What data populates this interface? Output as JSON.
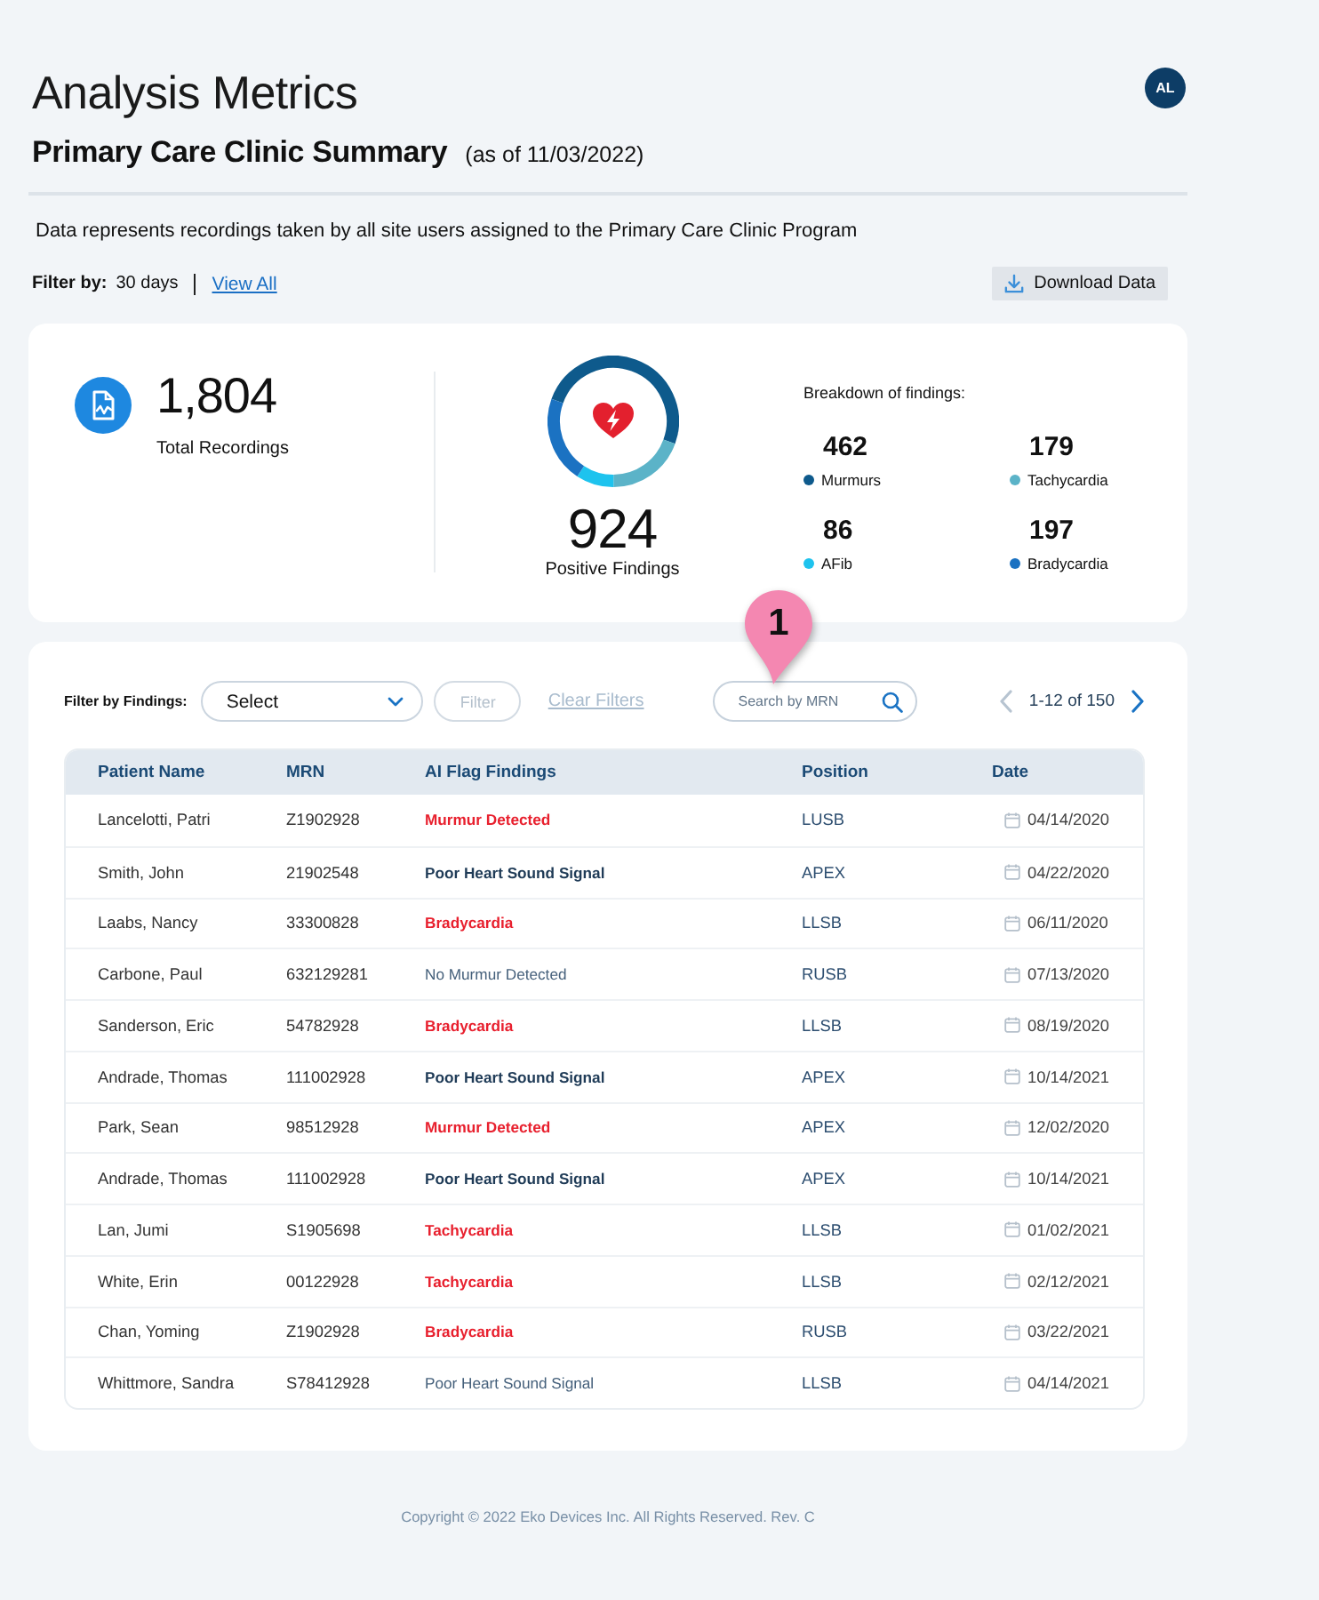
{
  "header": {
    "title": "Analysis Metrics",
    "avatar": {
      "initials": "AL"
    },
    "subtitle": "Primary Care Clinic Summary",
    "as_of": "(as of 11/03/2022)"
  },
  "description": "Data represents recordings taken by all site users assigned to the Primary Care Clinic Program",
  "filter_bar": {
    "label": "Filter by:",
    "value": "30 days",
    "link": "View All",
    "download_button": "Download Data"
  },
  "summary": {
    "total": {
      "value": "1,804",
      "label": "Total Recordings"
    },
    "positive": {
      "value": "924",
      "label": "Positive Findings"
    },
    "breakdown": {
      "title": "Breakdown of findings:",
      "items": [
        {
          "value": "462",
          "label": "Murmurs",
          "color": "#0e5a8c"
        },
        {
          "value": "179",
          "label": "Tachycardia",
          "color": "#5bb3c8"
        },
        {
          "value": "86",
          "label": "AFib",
          "color": "#1ec3ee"
        },
        {
          "value": "197",
          "label": "Bradycardia",
          "color": "#1b72c2"
        }
      ]
    }
  },
  "table_toolbar": {
    "label": "Filter by Findings:",
    "select": {
      "value": "Select"
    },
    "filter_button": {
      "label": "Filter",
      "disabled": true
    },
    "clear_filters": {
      "label": "Clear Filters",
      "disabled": true
    },
    "search": {
      "placeholder": "Search by MRN"
    },
    "pagination": {
      "range": "1-12 of 150",
      "previous_disabled": true,
      "next_disabled": false
    }
  },
  "table": {
    "columns": [
      "Patient Name",
      "MRN",
      "AI Flag Findings",
      "Position",
      "Date"
    ],
    "rows": [
      {
        "patient_name": "Lancelotti, Patri",
        "mrn": "Z1902928",
        "finding": {
          "text": "Murmur Detected",
          "kind": "alert"
        },
        "position": "LUSB",
        "date": "04/14/2020"
      },
      {
        "patient_name": "Smith, John",
        "mrn": "21902548",
        "finding": {
          "text": "Poor Heart Sound Signal",
          "kind": "emphasis"
        },
        "position": "APEX",
        "date": "04/22/2020"
      },
      {
        "patient_name": "Laabs, Nancy",
        "mrn": "33300828",
        "finding": {
          "text": "Bradycardia",
          "kind": "alert"
        },
        "position": "LLSB",
        "date": "06/11/2020"
      },
      {
        "patient_name": "Carbone, Paul",
        "mrn": "632129281",
        "finding": {
          "text": "No Murmur Detected",
          "kind": "plain"
        },
        "position": "RUSB",
        "date": "07/13/2020"
      },
      {
        "patient_name": "Sanderson, Eric",
        "mrn": "54782928",
        "finding": {
          "text": "Bradycardia",
          "kind": "alert"
        },
        "position": "LLSB",
        "date": "08/19/2020"
      },
      {
        "patient_name": "Andrade, Thomas",
        "mrn": "111002928",
        "finding": {
          "text": "Poor Heart Sound Signal",
          "kind": "emphasis"
        },
        "position": "APEX",
        "date": "10/14/2021"
      },
      {
        "patient_name": "Park, Sean",
        "mrn": "98512928",
        "finding": {
          "text": "Murmur Detected",
          "kind": "alert"
        },
        "position": "APEX",
        "date": "12/02/2020"
      },
      {
        "patient_name": "Andrade, Thomas",
        "mrn": "111002928",
        "finding": {
          "text": "Poor Heart Sound Signal",
          "kind": "emphasis"
        },
        "position": "APEX",
        "date": "10/14/2021"
      },
      {
        "patient_name": "Lan, Jumi",
        "mrn": "S1905698",
        "finding": {
          "text": "Tachycardia",
          "kind": "alert"
        },
        "position": "LLSB",
        "date": "01/02/2021"
      },
      {
        "patient_name": "White, Erin",
        "mrn": "00122928",
        "finding": {
          "text": "Tachycardia",
          "kind": "alert"
        },
        "position": "LLSB",
        "date": "02/12/2021"
      },
      {
        "patient_name": "Chan, Yoming",
        "mrn": "Z1902928",
        "finding": {
          "text": "Bradycardia",
          "kind": "alert"
        },
        "position": "RUSB",
        "date": "03/22/2021"
      },
      {
        "patient_name": "Whittmore, Sandra",
        "mrn": "S78412928",
        "finding": {
          "text": "Poor Heart Sound Signal",
          "kind": "plain"
        },
        "position": "LLSB",
        "date": "04/14/2021"
      }
    ]
  },
  "annotation": {
    "label": "1"
  },
  "footer": "Copyright © 2022 Eko Devices Inc. All Rights Reserved. Rev. C"
}
